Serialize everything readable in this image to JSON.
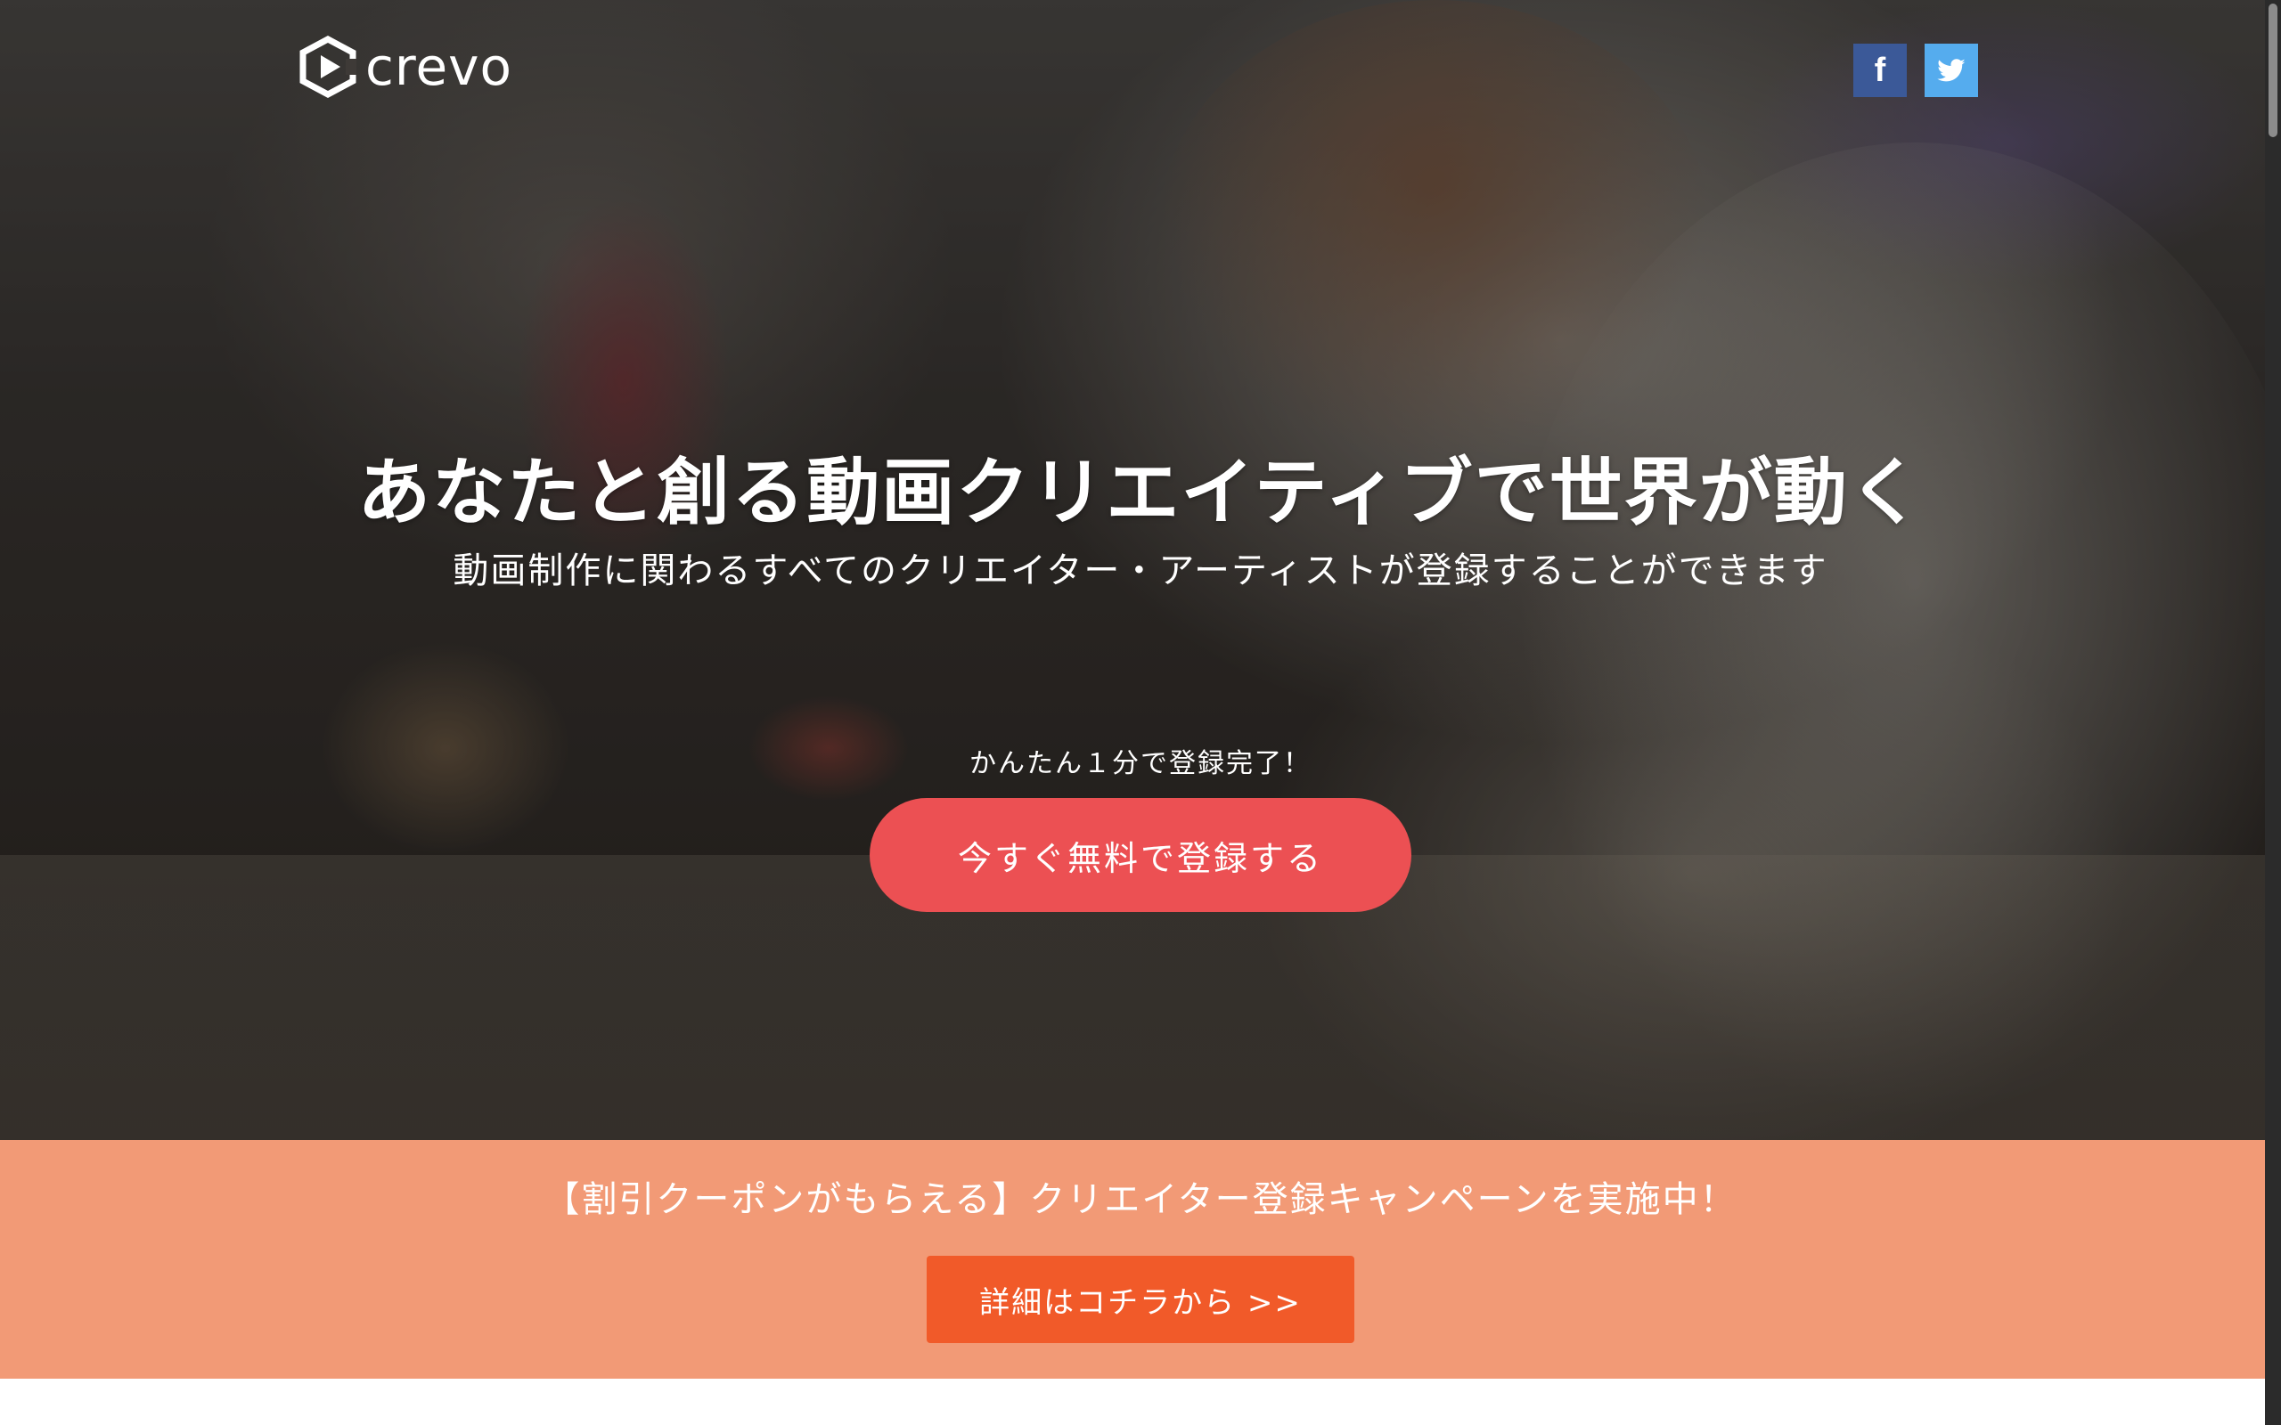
{
  "header": {
    "logo_text": "crevo",
    "social": {
      "facebook_label": "f",
      "twitter_icon": "twitter-bird-icon"
    }
  },
  "hero": {
    "title": "あなたと創る動画クリエイティブで世界が動く",
    "subtitle": "動画制作に関わるすべてのクリエイター・アーティストが登録することができます",
    "easy_text": "かんたん１分で登録完了！",
    "signup_button": "今すぐ無料で登録する"
  },
  "campaign": {
    "text": "【割引クーポンがもらえる】クリエイター登録キャンペーンを実施中！",
    "detail_button": "詳細はコチラから >>"
  },
  "colors": {
    "signup_button": "#ec5053",
    "campaign_band": "#f29a76",
    "detail_button": "#f15a29",
    "facebook": "#3b5998",
    "twitter": "#55acee"
  }
}
